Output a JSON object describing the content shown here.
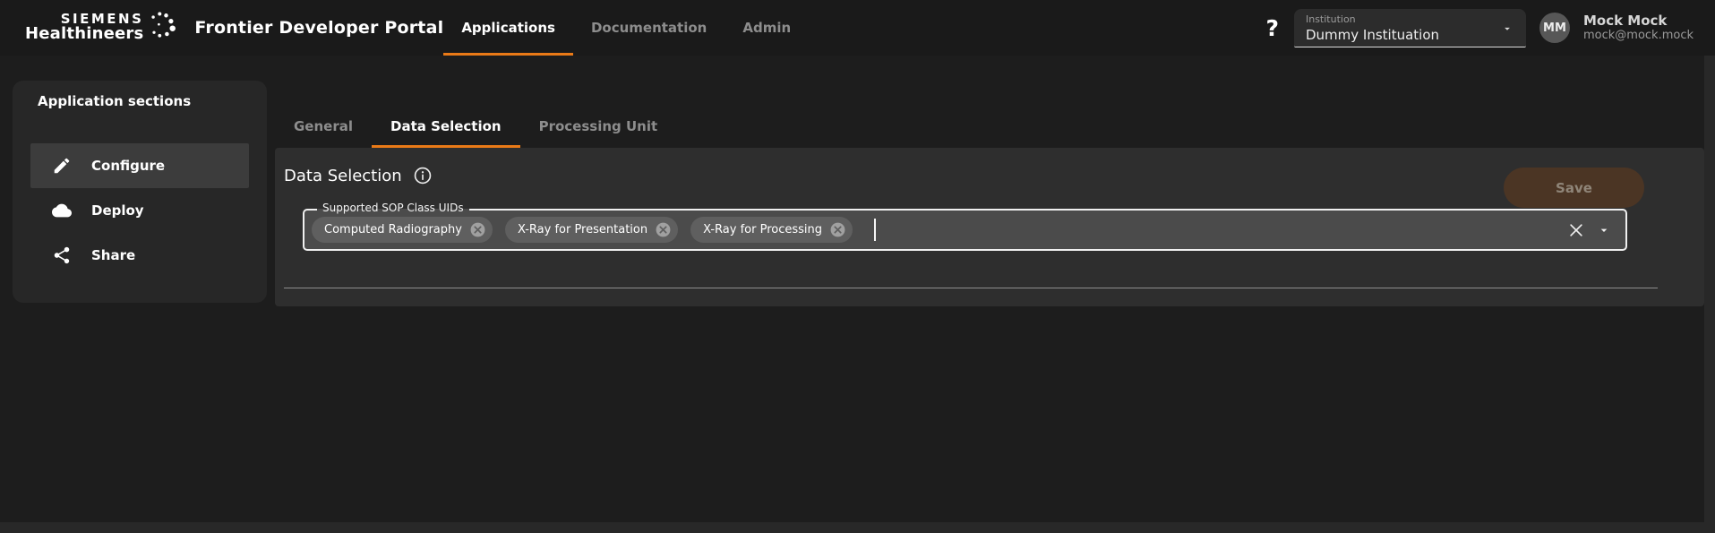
{
  "colors": {
    "accent_orange": "#ea7a17",
    "save_disabled_bg": "#4b3524",
    "panel_bg": "#2e2e2e",
    "chip_bg": "#5f5f5f"
  },
  "header": {
    "logo": {
      "line1": "SIEMENS",
      "line2": "Healthineers"
    },
    "portal_title": "Frontier Developer Portal",
    "nav": [
      {
        "label": "Applications",
        "active": true
      },
      {
        "label": "Documentation",
        "active": false
      },
      {
        "label": "Admin",
        "active": false
      }
    ],
    "help_label": "?",
    "institution": {
      "label": "Institution",
      "value": "Dummy Instituation"
    },
    "user": {
      "initials": "MM",
      "name": "Mock Mock",
      "email": "mock@mock.mock"
    }
  },
  "sidebar": {
    "title": "Application sections",
    "items": [
      {
        "label": "Configure",
        "icon": "pencil-icon",
        "active": true
      },
      {
        "label": "Deploy",
        "icon": "cloud-icon",
        "active": false
      },
      {
        "label": "Share",
        "icon": "share-icon",
        "active": false
      }
    ]
  },
  "main": {
    "tabs": [
      {
        "label": "General",
        "active": false
      },
      {
        "label": "Data Selection",
        "active": true
      },
      {
        "label": "Processing Unit",
        "active": false
      }
    ],
    "section": {
      "title": "Data Selection",
      "info_icon": "info-icon",
      "save_label": "Save",
      "field": {
        "label": "Supported SOP Class UIDs",
        "chips": [
          "Computed Radiography",
          "X-Ray for Presentation",
          "X-Ray for Processing"
        ],
        "clear_icon": "clear-x-icon",
        "dropdown_icon": "chevron-down-icon"
      }
    }
  }
}
